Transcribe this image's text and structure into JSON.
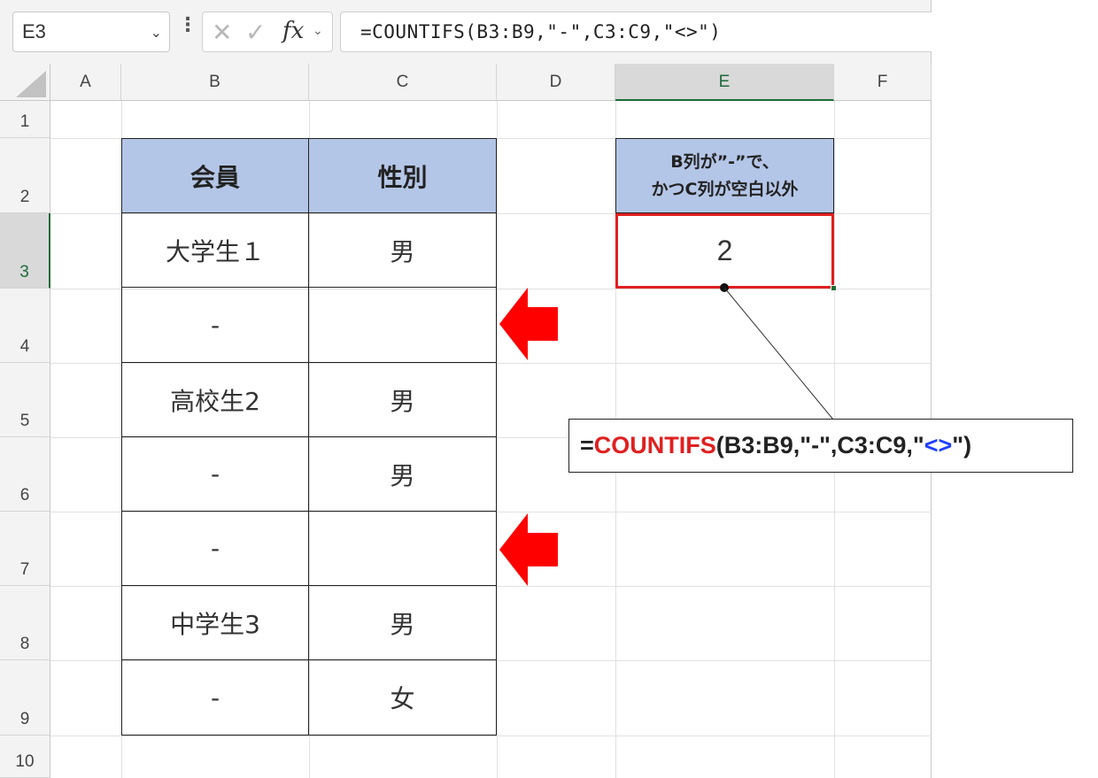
{
  "formula_bar": {
    "name_box": "E3",
    "formula": "=COUNTIFS(B3:B9,\"-\",C3:C9,\"<>\")"
  },
  "columns": [
    "A",
    "B",
    "C",
    "D",
    "E",
    "F"
  ],
  "rows": [
    "1",
    "2",
    "3",
    "4",
    "5",
    "6",
    "7",
    "8",
    "9",
    "10"
  ],
  "selected_cell": "E3",
  "table": {
    "headers": [
      "会員",
      "性別"
    ],
    "rows": [
      [
        "大学生１",
        "男"
      ],
      [
        "-",
        ""
      ],
      [
        "高校生2",
        "男"
      ],
      [
        "-",
        "男"
      ],
      [
        "-",
        ""
      ],
      [
        "中学生3",
        "男"
      ],
      [
        "-",
        "女"
      ]
    ]
  },
  "result_header": {
    "line1": "B列が”-”で、",
    "line2": "かつC列が空白以外"
  },
  "result_value": "2",
  "callout": {
    "prefix": "=",
    "function": "COUNTIFS",
    "middle": "(B3:B9,\"-\",C3:C9,\"",
    "operator": "<>",
    "suffix": "\")"
  },
  "colors": {
    "header_fill": "#b4c6e7",
    "highlight_red": "#e02020",
    "operator_blue": "#1f3fff",
    "excel_green": "#1d6b39"
  }
}
